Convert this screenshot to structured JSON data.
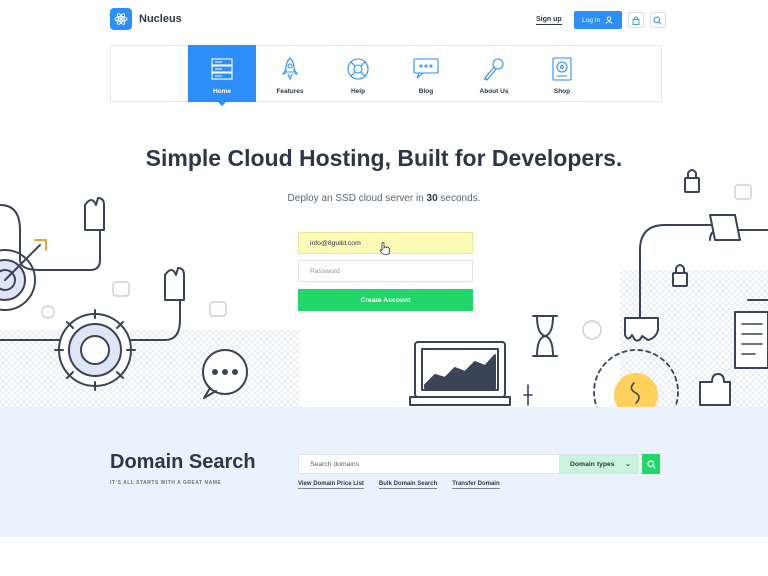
{
  "brand": {
    "name": "Nucleus",
    "accent": "#2c8ef8",
    "green": "#21d769"
  },
  "header": {
    "signup_label": "Sign up",
    "login_label": "Log In",
    "icons": [
      "user-icon",
      "lock-icon",
      "search-icon"
    ]
  },
  "nav": {
    "items": [
      {
        "label": "Home",
        "icon": "server-icon",
        "active": true
      },
      {
        "label": "Features",
        "icon": "rocket-icon",
        "active": false
      },
      {
        "label": "Help",
        "icon": "lifebuoy-icon",
        "active": false
      },
      {
        "label": "Blog",
        "icon": "chat-bubbles-icon",
        "active": false
      },
      {
        "label": "About Us",
        "icon": "microphone-icon",
        "active": false
      },
      {
        "label": "Shop",
        "icon": "hard-drive-icon",
        "active": false
      }
    ]
  },
  "hero": {
    "title": "Simple Cloud Hosting, Built for Developers.",
    "subtitle_before": "Deploy an SSD cloud server in ",
    "subtitle_bold": "30",
    "subtitle_after": " seconds."
  },
  "signup_form": {
    "email_value": "info@8guild.com",
    "password_placeholder": "Password",
    "submit_label": "Create Account"
  },
  "domain": {
    "title": "Domain Search",
    "tagline": "IT`S ALL STARTS WITH A GREAT NAME",
    "search_placeholder": "Search domains",
    "types_label": "Domain types",
    "links": [
      "View Domain Price List",
      "Bulk Domain Search",
      "Transfer Domain"
    ]
  }
}
